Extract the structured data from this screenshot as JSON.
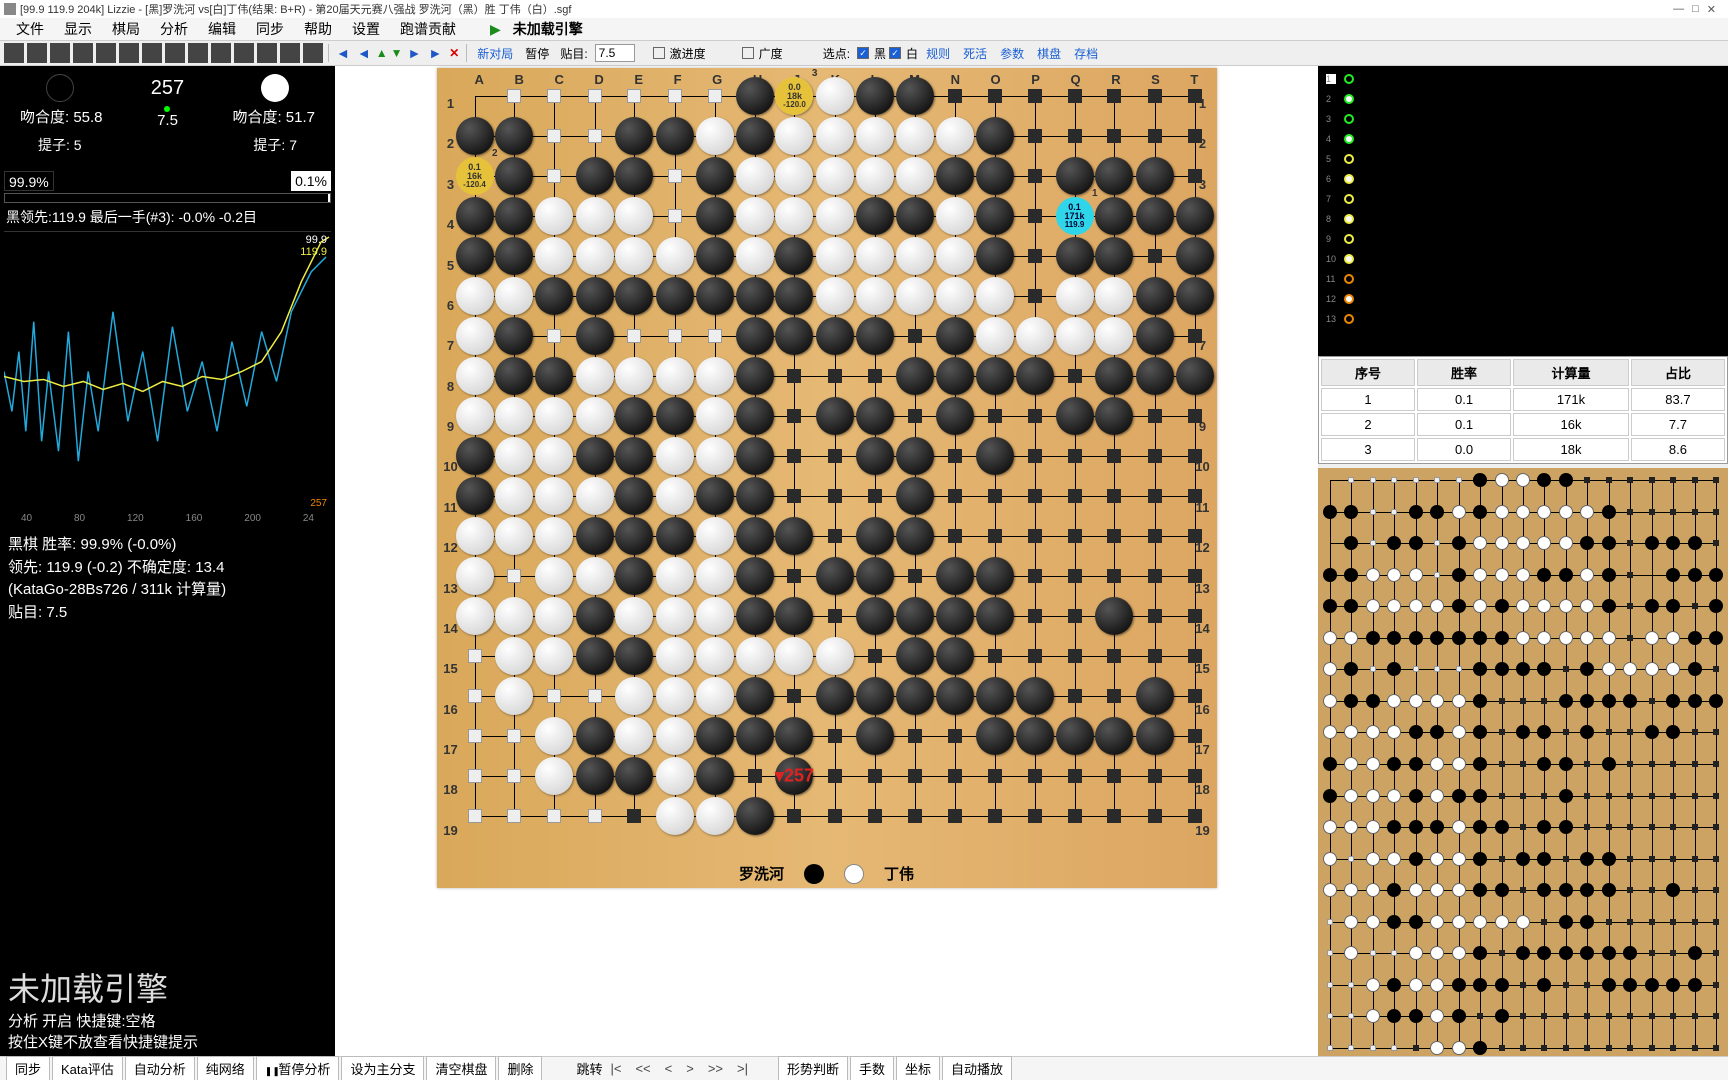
{
  "title": "[99.9 119.9 204k] Lizzie - [黑]罗洗河 vs[白]丁伟(结果: B+R) - 第20届天元赛八强战 罗洗河（黑）胜 丁伟（白）.sgf",
  "menu": [
    "文件",
    "显示",
    "棋局",
    "分析",
    "编辑",
    "同步",
    "帮助",
    "设置",
    "跑谱贡献"
  ],
  "engine_status": "未加载引擎",
  "toolbar": {
    "pause": "暂停",
    "komi_lbl": "贴目:",
    "komi": "7.5",
    "aggr": "激进度",
    "breadth": "广度",
    "point": "选点:",
    "black": "黑",
    "white": "白",
    "links": [
      "新对局",
      "规则",
      "死活",
      "参数",
      "棋盘",
      "存档"
    ]
  },
  "info": {
    "move": "257",
    "match_b": "吻合度: 55.8",
    "match_w": "吻合度: 51.7",
    "cap_b": "提子: 5",
    "cap_w": "提子: 7",
    "center": "7.5",
    "wr_b": "99.9%",
    "wr_w": "0.1%",
    "graph_head": "黑领先:119.9 最后一手(#3): -0.0% -0.2目",
    "g_r1": "99.9",
    "g_r2": "119.9",
    "g_r3": "257",
    "ticks": [
      "40",
      "80",
      "120",
      "160",
      "200",
      "24"
    ],
    "lines": [
      "黑棋 胜率: 99.9% (-0.0%)",
      "领先: 119.9 (-0.2) 不确定度: 13.4",
      "(KataGo-28Bs726 / 311k 计算量)",
      "贴目: 7.5"
    ],
    "warn_big": "未加载引擎",
    "warn_l1": "分析 开启  快捷键:空格",
    "warn_l2": "按住X键不放查看快捷键提示"
  },
  "board": {
    "cols": [
      "A",
      "B",
      "C",
      "D",
      "E",
      "F",
      "G",
      "H",
      "J",
      "K",
      "L",
      "M",
      "N",
      "O",
      "P",
      "Q",
      "R",
      "S",
      "T"
    ],
    "rows": [
      "1",
      "2",
      "3",
      "4",
      "5",
      "6",
      "7",
      "8",
      "9",
      "10",
      "11",
      "12",
      "13",
      "14",
      "15",
      "16",
      "17",
      "18",
      "19"
    ],
    "p_black": "罗洗河",
    "p_white": "丁伟",
    "last": "257",
    "candidates": [
      {
        "pos": "J1",
        "wr": "0.0",
        "vis": "18k",
        "sc": "-120.0",
        "cls": "cand-y",
        "n": "3"
      },
      {
        "pos": "A3",
        "wr": "0.1",
        "vis": "16k",
        "sc": "-120.4",
        "cls": "cand-y",
        "n": "2"
      },
      {
        "pos": "Q4",
        "wr": "0.1",
        "vis": "171k",
        "sc": "119.9",
        "cls": "cand-c",
        "n": "1"
      }
    ]
  },
  "table": {
    "head": [
      "序号",
      "胜率",
      "计算量",
      "占比"
    ],
    "rows": [
      [
        "1",
        "0.1",
        "171k",
        "83.7"
      ],
      [
        "2",
        "0.1",
        "16k",
        "7.7"
      ],
      [
        "3",
        "0.0",
        "18k",
        "8.6"
      ]
    ]
  },
  "bottombar": {
    "btns": [
      "同步",
      "Kata评估",
      "自动分析",
      "纯网络"
    ],
    "pause": "暂停分析",
    "btns2": [
      "设为主分支",
      "清空棋盘",
      "删除"
    ],
    "nav_lbl": "跳转",
    "nav": [
      "|<",
      "<<",
      "<",
      ">",
      ">>",
      ">|"
    ],
    "btns3": [
      "形势判断",
      "手数",
      "坐标",
      "自动播放"
    ]
  },
  "stones": {
    "B": [
      "H1",
      "L1",
      "M1",
      "A2",
      "B2",
      "E2",
      "F2",
      "H2",
      "O2",
      "B3",
      "D3",
      "E3",
      "G3",
      "N3",
      "O3",
      "Q3",
      "R3",
      "S3",
      "A4",
      "B4",
      "G4",
      "L4",
      "M4",
      "O4",
      "R4",
      "S4",
      "T4",
      "A5",
      "B5",
      "G5",
      "J5",
      "O5",
      "Q5",
      "R5",
      "T5",
      "C6",
      "D6",
      "E6",
      "F6",
      "G6",
      "H6",
      "J6",
      "S6",
      "T6",
      "B7",
      "D7",
      "H7",
      "J7",
      "K7",
      "L7",
      "N7",
      "S7",
      "B8",
      "C8",
      "H8",
      "M8",
      "N8",
      "O8",
      "P8",
      "R8",
      "S8",
      "T8",
      "E9",
      "F9",
      "H9",
      "K9",
      "L9",
      "N9",
      "Q9",
      "R9",
      "A10",
      "D10",
      "E10",
      "H10",
      "L10",
      "M10",
      "O10",
      "A11",
      "E11",
      "G11",
      "H11",
      "M11",
      "D12",
      "E12",
      "F12",
      "H12",
      "J12",
      "L12",
      "M12",
      "E13",
      "H13",
      "K13",
      "L13",
      "N13",
      "O13",
      "D14",
      "H14",
      "J14",
      "L14",
      "M14",
      "N14",
      "O14",
      "R14",
      "D15",
      "E15",
      "M15",
      "N15",
      "H16",
      "K16",
      "L16",
      "M16",
      "N16",
      "O16",
      "P16",
      "S16",
      "D17",
      "G17",
      "H17",
      "J17",
      "L17",
      "O17",
      "P17",
      "Q17",
      "R17",
      "S17",
      "D18",
      "E18",
      "G18",
      "J18",
      "H19"
    ],
    "W": [
      "J1",
      "K1",
      "G2",
      "J2",
      "K2",
      "L2",
      "M2",
      "N2",
      "H3",
      "J3",
      "K3",
      "L3",
      "M3",
      "C4",
      "D4",
      "E4",
      "H4",
      "J4",
      "K4",
      "N4",
      "C5",
      "D5",
      "E5",
      "F5",
      "H5",
      "K5",
      "L5",
      "M5",
      "N5",
      "A6",
      "B6",
      "K6",
      "L6",
      "M6",
      "N6",
      "O6",
      "Q6",
      "R6",
      "A7",
      "O7",
      "P7",
      "Q7",
      "R7",
      "A8",
      "D8",
      "E8",
      "F8",
      "G8",
      "A9",
      "B9",
      "C9",
      "D9",
      "G9",
      "B10",
      "C10",
      "F10",
      "G10",
      "B11",
      "C11",
      "D11",
      "F11",
      "A12",
      "B12",
      "C12",
      "G12",
      "A13",
      "C13",
      "D13",
      "F13",
      "G13",
      "A14",
      "B14",
      "C14",
      "E14",
      "F14",
      "G14",
      "B15",
      "C15",
      "F15",
      "G15",
      "H15",
      "J15",
      "K15",
      "B16",
      "E16",
      "F16",
      "G16",
      "C17",
      "E17",
      "F17",
      "C18",
      "F18",
      "F19",
      "G19"
    ]
  },
  "territory": {
    "B": [
      "N1",
      "O1",
      "P1",
      "Q1",
      "R1",
      "S1",
      "T1",
      "P2",
      "Q2",
      "R2",
      "S2",
      "T2",
      "P3",
      "T3",
      "P4",
      "P5",
      "S5",
      "P6",
      "M7",
      "T7",
      "J8",
      "K8",
      "L8",
      "Q8",
      "J9",
      "M9",
      "O9",
      "P9",
      "S9",
      "T9",
      "J10",
      "K10",
      "N10",
      "P10",
      "Q10",
      "R10",
      "S10",
      "T10",
      "J11",
      "K11",
      "L11",
      "N11",
      "O11",
      "P11",
      "Q11",
      "R11",
      "S11",
      "T11",
      "K12",
      "N12",
      "O12",
      "P12",
      "Q12",
      "R12",
      "S12",
      "T12",
      "J13",
      "M13",
      "P13",
      "Q13",
      "R13",
      "S13",
      "T13",
      "K14",
      "P14",
      "Q14",
      "S14",
      "T14",
      "L15",
      "O15",
      "P15",
      "Q15",
      "R15",
      "S15",
      "T15",
      "J16",
      "Q16",
      "R16",
      "T16",
      "K17",
      "M17",
      "N17",
      "T17",
      "H18",
      "K18",
      "L18",
      "M18",
      "N18",
      "O18",
      "P18",
      "Q18",
      "R18",
      "S18",
      "T18",
      "E19",
      "J19",
      "K19",
      "L19",
      "M19",
      "N19",
      "O19",
      "P19",
      "Q19",
      "R19",
      "S19",
      "T19"
    ],
    "W": [
      "B1",
      "C1",
      "D1",
      "E1",
      "F1",
      "G1",
      "C2",
      "D2",
      "C3",
      "F3",
      "F4",
      "C7",
      "E7",
      "F7",
      "G7",
      "B13",
      "A15",
      "A16",
      "C16",
      "D16",
      "A17",
      "B17",
      "A18",
      "B18",
      "A19",
      "B19",
      "C19",
      "D19"
    ]
  }
}
